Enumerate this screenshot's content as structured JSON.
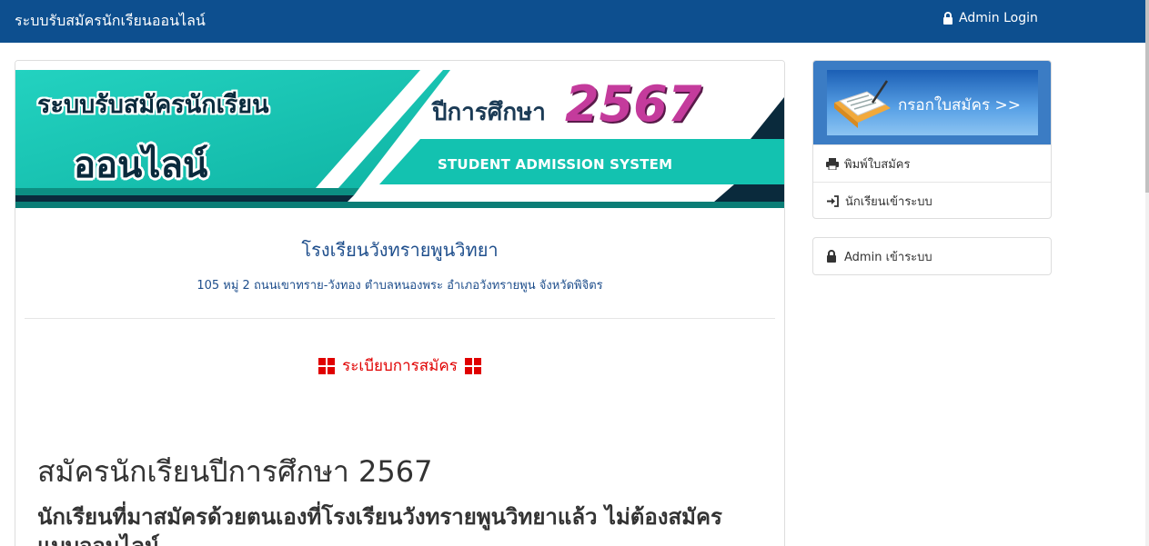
{
  "navbar": {
    "brand": "ระบบรับสมัครนักเรียนออนไลน์",
    "admin_login": "Admin Login"
  },
  "banner": {
    "title_line1": "ระบบรับสมัครนักเรียน",
    "title_line2": "ออนไลน์",
    "year_label": "ปีการศึกษา",
    "year": "2567",
    "subtitle": "STUDENT ADMISSION SYSTEM"
  },
  "school": {
    "name": "โรงเรียนวังทรายพูนวิทยา",
    "address": "105 หมู่ 2 ถนนเขาทราย-วังทอง ตำบลหนองพระ อำเภอวังทรายพูน จังหวัดพิจิตร"
  },
  "section": {
    "heading": "ระเบียบการสมัคร"
  },
  "content": {
    "headline": "สมัครนักเรียนปีการศึกษา 2567",
    "subheadline": "นักเรียนที่มาสมัครด้วยตนเองที่โรงเรียนวังทรายพูนวิทยาแล้ว ไม่ต้องสมัครแบบออนไลน์"
  },
  "sidebar": {
    "apply_button": "กรอกใบสมัคร >>",
    "print_form": "พิมพ์ใบสมัคร",
    "student_login": "นักเรียนเข้าระบบ",
    "admin_login": "Admin เข้าระบบ"
  },
  "colors": {
    "navbar": "#0d4f8f",
    "teal": "#13c2b0",
    "link_blue": "#1e4e8c",
    "heading_red": "#e00000"
  }
}
